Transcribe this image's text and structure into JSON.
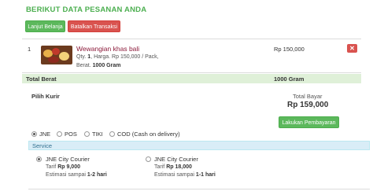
{
  "page": {
    "title": "BERIKUT DATA PESANAN ANDA"
  },
  "actions": {
    "continue_label": "Lanjut Belanja",
    "cancel_label": "Batalkan Transaksi"
  },
  "item": {
    "number": "1",
    "name": "Wewangian khas bali",
    "qty_prefix": "Qty.",
    "qty_value": "1",
    "harga_prefix": ", Harga.",
    "harga_value": "Rp 150,000",
    "per_pack": "/ Pack,",
    "berat_prefix": "Berat.",
    "berat_value": "1000 Gram",
    "price": "Rp 150,000",
    "delete_symbol": "✕"
  },
  "summary": {
    "total_weight_label": "Total Berat",
    "total_weight_value": "1000 Gram",
    "courier_label": "Pilih Kurir",
    "total_pay_label": "Total Bayar",
    "total_pay_value": "Rp 159,000",
    "pay_button_label": "Lakukan Pembayaran"
  },
  "couriers": {
    "options": [
      "JNE",
      "POS",
      "TIKI",
      "COD (Cash on delivery)"
    ],
    "selected": "JNE"
  },
  "services": {
    "header": "Service",
    "tarif_prefix": "Tarif",
    "estimasi_prefix": "Estimasi sampai",
    "items": [
      {
        "name": "JNE City Courier",
        "tarif": "Rp 9,000",
        "estimasi": "1-2 hari",
        "selected": true
      },
      {
        "name": "JNE City Courier",
        "tarif": "Rp 18,000",
        "estimasi": "1-1 hari",
        "selected": false
      }
    ]
  },
  "colors": {
    "title": "#4caf50",
    "success": "#5cb85c",
    "danger": "#d9534f",
    "product_name": "#8b1a3a",
    "weight_row": "#dff0d8",
    "service_header": "#d9edf7"
  }
}
